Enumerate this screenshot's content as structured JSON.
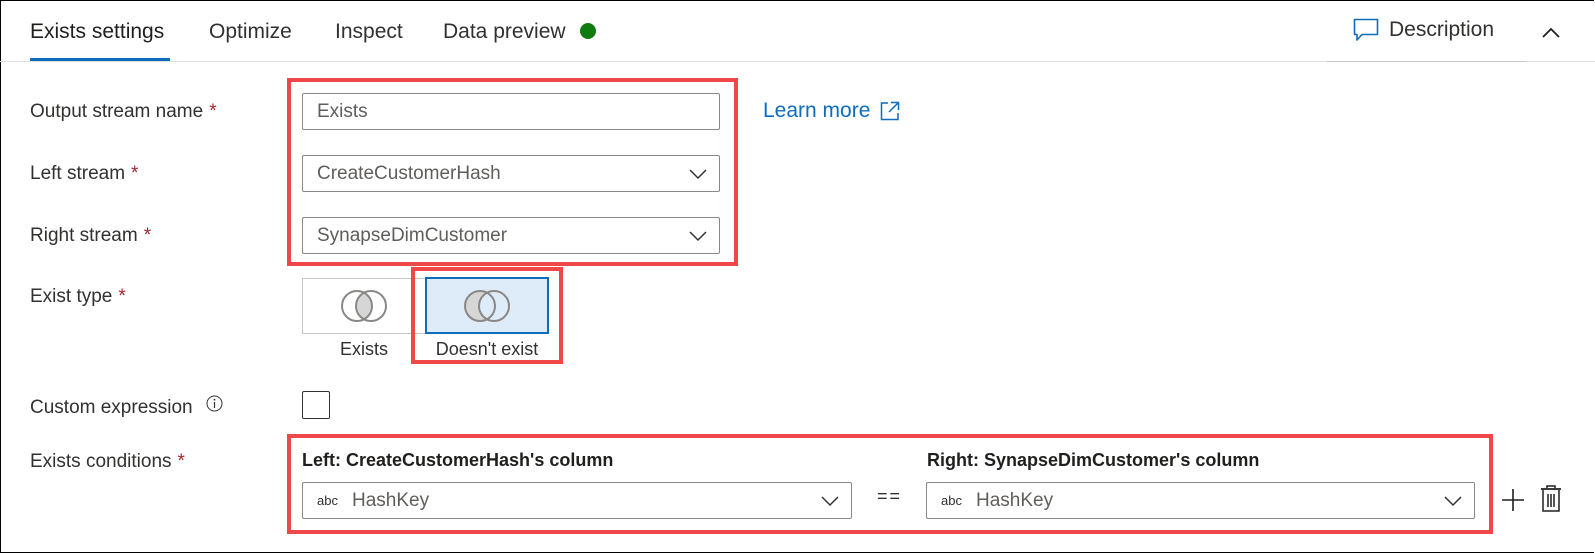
{
  "tabs": [
    {
      "label": "Exists settings",
      "active": true
    },
    {
      "label": "Optimize",
      "active": false
    },
    {
      "label": "Inspect",
      "active": false
    },
    {
      "label": "Data preview",
      "active": false,
      "status_dot": "green",
      "status_color": "#107c10"
    }
  ],
  "header_actions": {
    "description_label": "Description",
    "description_icon": "comment-icon",
    "collapse_icon": "chevron-up-icon"
  },
  "form": {
    "output_stream_name": {
      "label": "Output stream name",
      "required_mark": "*",
      "value": "Exists"
    },
    "learn_more": {
      "label": "Learn more",
      "icon": "external-link-icon"
    },
    "left_stream": {
      "label": "Left stream",
      "required_mark": "*",
      "value": "CreateCustomerHash"
    },
    "right_stream": {
      "label": "Right stream",
      "required_mark": "*",
      "value": "SynapseDimCustomer"
    },
    "exist_type": {
      "label": "Exist type",
      "required_mark": "*",
      "options": [
        {
          "label": "Exists",
          "icon": "venn-intersection-icon",
          "selected": false
        },
        {
          "label": "Doesn't exist",
          "icon": "venn-left-only-icon",
          "selected": true
        }
      ]
    },
    "custom_expression": {
      "label": "Custom expression",
      "checked": false,
      "info_icon": "info-icon"
    },
    "exists_conditions": {
      "label": "Exists conditions",
      "required_mark": "*",
      "left_header": "Left: CreateCustomerHash's column",
      "right_header": "Right: SynapseDimCustomer's column",
      "operator": "==",
      "rows": [
        {
          "left_type": "abc",
          "left_value": "HashKey",
          "right_type": "abc",
          "right_value": "HashKey"
        }
      ]
    }
  },
  "colors": {
    "accent": "#0f6cbd",
    "highlight_box": "#f04848",
    "required": "#a4262c",
    "selected_bg": "#deecf9"
  }
}
